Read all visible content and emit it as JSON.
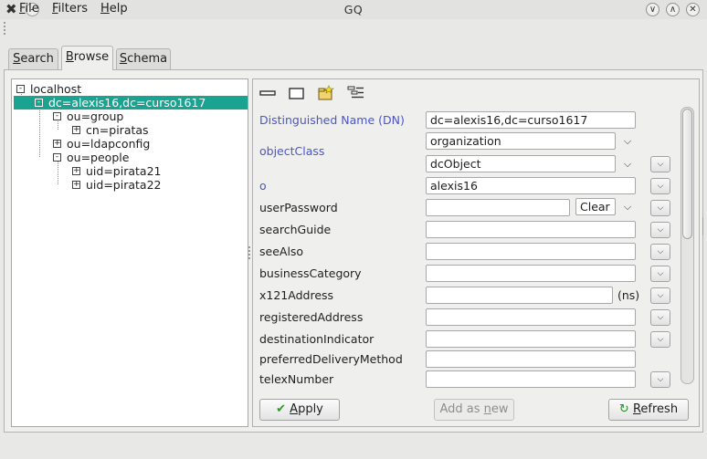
{
  "window": {
    "title": "GQ",
    "app_icon": "gq-app-icon",
    "controls": [
      "minimize-icon",
      "maximize-icon",
      "close-icon"
    ]
  },
  "menu": {
    "items": [
      {
        "hot": "F",
        "rest": "ile"
      },
      {
        "hot": "F",
        "rest": "ilters"
      },
      {
        "hot": "H",
        "rest": "elp"
      }
    ]
  },
  "tabs": [
    {
      "hot": "S",
      "rest": "earch",
      "active": false
    },
    {
      "hot": "B",
      "rest": "rowse",
      "active": true
    },
    {
      "hot": "S",
      "rest": "chema",
      "active": false
    }
  ],
  "tree": {
    "nodes": [
      {
        "label": "localhost",
        "expander": "-",
        "selected": false
      },
      {
        "label": "dc=alexis16,dc=curso1617",
        "expander": "-",
        "selected": true
      },
      {
        "label": "ou=group",
        "expander": "-",
        "selected": false
      },
      {
        "label": "cn=piratas",
        "expander": "+",
        "selected": false
      },
      {
        "label": "ou=ldapconfig",
        "expander": "+",
        "selected": false
      },
      {
        "label": "ou=people",
        "expander": "-",
        "selected": false
      },
      {
        "label": "uid=pirata21",
        "expander": "+",
        "selected": false
      },
      {
        "label": "uid=pirata22",
        "expander": "+",
        "selected": false
      }
    ]
  },
  "toolbar": {
    "icons": [
      "collapse-all-icon",
      "new-entry-icon",
      "folder-new-icon",
      "show-attributes-icon"
    ]
  },
  "attributes": {
    "dn_label": "Distinguished Name (DN)",
    "dn_value": "dc=alexis16,dc=curso1617",
    "objectclass_label": "objectClass",
    "objectclass_values": [
      "organization",
      "dcObject"
    ],
    "o_label": "o",
    "o_value": "alexis16",
    "userpassword_label": "userPassword",
    "userpassword_value": "",
    "userpassword_hash": "Clear",
    "searchguide_label": "searchGuide",
    "seealso_label": "seeAlso",
    "businesscategory_label": "businessCategory",
    "x121address_label": "x121Address",
    "x121address_suffix": "(ns)",
    "registeredaddress_label": "registeredAddress",
    "destinationindicator_label": "destinationIndicator",
    "preferreddeliverymethod_label": "preferredDeliveryMethod",
    "telexnumber_label": "telexNumber"
  },
  "buttons": {
    "apply": {
      "hot": "A",
      "rest": "pply"
    },
    "add_new": {
      "pre": "Add as ",
      "hot": "n",
      "rest": "ew"
    },
    "refresh": {
      "hot": "R",
      "rest": "efresh"
    }
  }
}
